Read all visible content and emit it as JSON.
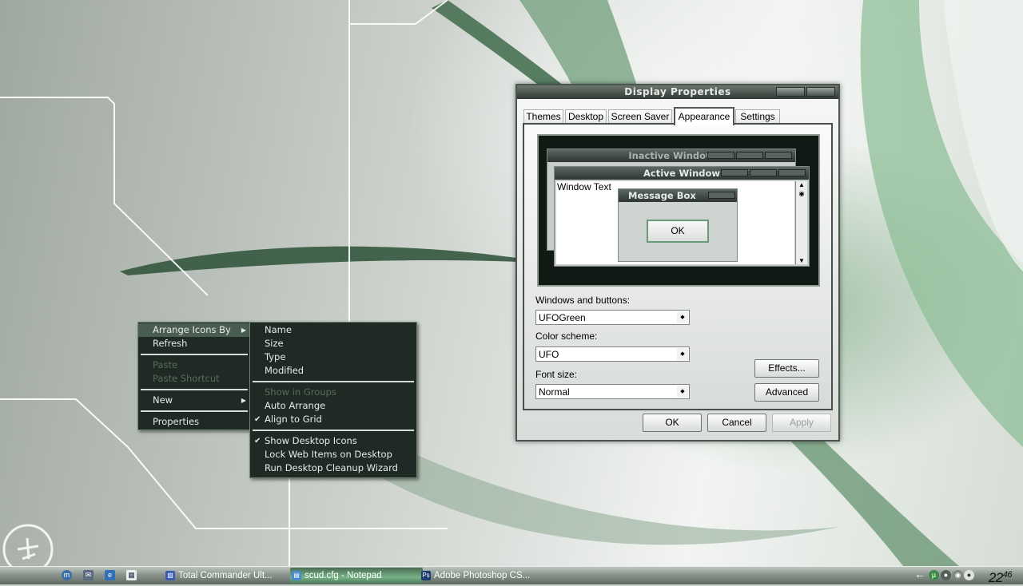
{
  "context_menu": {
    "items": [
      {
        "label": "Arrange Icons By",
        "disabled": false
      },
      {
        "label": "Refresh",
        "disabled": false
      },
      {
        "label": "Paste",
        "disabled": true
      },
      {
        "label": "Paste Shortcut",
        "disabled": true
      },
      {
        "label": "New",
        "disabled": false
      },
      {
        "label": "Properties",
        "disabled": false
      }
    ]
  },
  "submenu": {
    "items": [
      {
        "label": "Name"
      },
      {
        "label": "Size"
      },
      {
        "label": "Type"
      },
      {
        "label": "Modified"
      },
      {
        "label": "Show in Groups",
        "disabled": true
      },
      {
        "label": "Auto Arrange"
      },
      {
        "label": "Align to Grid",
        "checked": true
      },
      {
        "label": "Show Desktop Icons",
        "checked": true
      },
      {
        "label": "Lock Web Items on Desktop"
      },
      {
        "label": "Run Desktop Cleanup Wizard"
      }
    ]
  },
  "dialog": {
    "title": "Display Properties",
    "tabs": [
      "Themes",
      "Desktop",
      "Screen Saver",
      "Appearance",
      "Settings"
    ],
    "active_tab": "Appearance",
    "preview": {
      "inactive_title": "Inactive Window",
      "active_title": "Active Window",
      "window_text": "Window Text",
      "message_title": "Message Box",
      "ok_label": "OK"
    },
    "windows_buttons_label": "Windows and buttons:",
    "windows_buttons_value": "UFOGreen",
    "color_scheme_label": "Color scheme:",
    "color_scheme_value": "UFO",
    "font_size_label": "Font size:",
    "font_size_value": "Normal",
    "effects_label": "Effects...",
    "advanced_label": "Advanced",
    "ok_label": "OK",
    "cancel_label": "Cancel",
    "apply_label": "Apply"
  },
  "taskbar": {
    "tasks": [
      {
        "label": "Total Commander Ult...",
        "icon": "total-commander-icon",
        "active": false
      },
      {
        "label": "scud.cfg - Notepad",
        "icon": "notepad-icon",
        "active": true
      },
      {
        "label": "Adobe Photoshop CS...",
        "icon": "photoshop-icon",
        "active": false
      }
    ],
    "photoshop_icon_text": "Ps",
    "clock_hours": "22",
    "clock_minutes": "46"
  },
  "colors": {
    "menu_bg": "#1f2a25",
    "accent_green": "#6b9a76"
  }
}
